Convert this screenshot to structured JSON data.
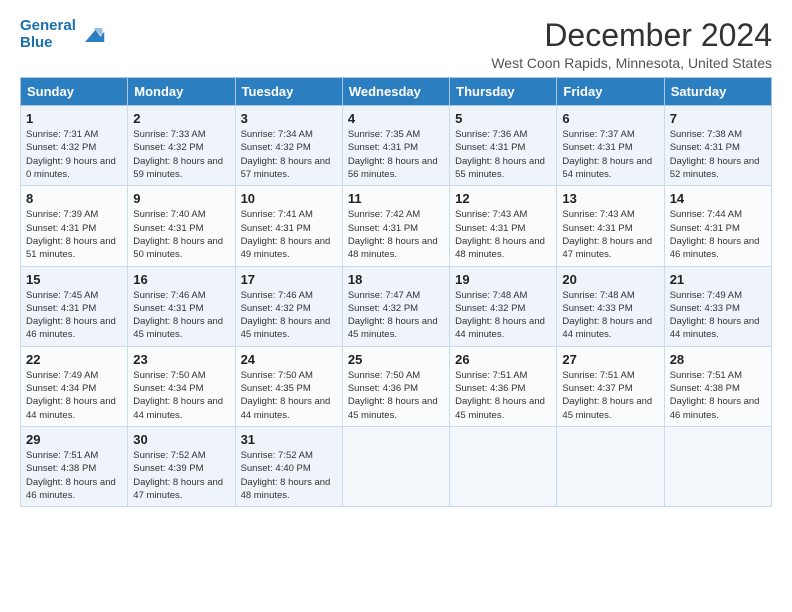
{
  "header": {
    "logo_line1": "General",
    "logo_line2": "Blue",
    "month": "December 2024",
    "location": "West Coon Rapids, Minnesota, United States"
  },
  "days_of_week": [
    "Sunday",
    "Monday",
    "Tuesday",
    "Wednesday",
    "Thursday",
    "Friday",
    "Saturday"
  ],
  "weeks": [
    [
      {
        "day": "1",
        "sunrise": "7:31 AM",
        "sunset": "4:32 PM",
        "daylight": "9 hours and 0 minutes."
      },
      {
        "day": "2",
        "sunrise": "7:33 AM",
        "sunset": "4:32 PM",
        "daylight": "8 hours and 59 minutes."
      },
      {
        "day": "3",
        "sunrise": "7:34 AM",
        "sunset": "4:32 PM",
        "daylight": "8 hours and 57 minutes."
      },
      {
        "day": "4",
        "sunrise": "7:35 AM",
        "sunset": "4:31 PM",
        "daylight": "8 hours and 56 minutes."
      },
      {
        "day": "5",
        "sunrise": "7:36 AM",
        "sunset": "4:31 PM",
        "daylight": "8 hours and 55 minutes."
      },
      {
        "day": "6",
        "sunrise": "7:37 AM",
        "sunset": "4:31 PM",
        "daylight": "8 hours and 54 minutes."
      },
      {
        "day": "7",
        "sunrise": "7:38 AM",
        "sunset": "4:31 PM",
        "daylight": "8 hours and 52 minutes."
      }
    ],
    [
      {
        "day": "8",
        "sunrise": "7:39 AM",
        "sunset": "4:31 PM",
        "daylight": "8 hours and 51 minutes."
      },
      {
        "day": "9",
        "sunrise": "7:40 AM",
        "sunset": "4:31 PM",
        "daylight": "8 hours and 50 minutes."
      },
      {
        "day": "10",
        "sunrise": "7:41 AM",
        "sunset": "4:31 PM",
        "daylight": "8 hours and 49 minutes."
      },
      {
        "day": "11",
        "sunrise": "7:42 AM",
        "sunset": "4:31 PM",
        "daylight": "8 hours and 48 minutes."
      },
      {
        "day": "12",
        "sunrise": "7:43 AM",
        "sunset": "4:31 PM",
        "daylight": "8 hours and 48 minutes."
      },
      {
        "day": "13",
        "sunrise": "7:43 AM",
        "sunset": "4:31 PM",
        "daylight": "8 hours and 47 minutes."
      },
      {
        "day": "14",
        "sunrise": "7:44 AM",
        "sunset": "4:31 PM",
        "daylight": "8 hours and 46 minutes."
      }
    ],
    [
      {
        "day": "15",
        "sunrise": "7:45 AM",
        "sunset": "4:31 PM",
        "daylight": "8 hours and 46 minutes."
      },
      {
        "day": "16",
        "sunrise": "7:46 AM",
        "sunset": "4:31 PM",
        "daylight": "8 hours and 45 minutes."
      },
      {
        "day": "17",
        "sunrise": "7:46 AM",
        "sunset": "4:32 PM",
        "daylight": "8 hours and 45 minutes."
      },
      {
        "day": "18",
        "sunrise": "7:47 AM",
        "sunset": "4:32 PM",
        "daylight": "8 hours and 45 minutes."
      },
      {
        "day": "19",
        "sunrise": "7:48 AM",
        "sunset": "4:32 PM",
        "daylight": "8 hours and 44 minutes."
      },
      {
        "day": "20",
        "sunrise": "7:48 AM",
        "sunset": "4:33 PM",
        "daylight": "8 hours and 44 minutes."
      },
      {
        "day": "21",
        "sunrise": "7:49 AM",
        "sunset": "4:33 PM",
        "daylight": "8 hours and 44 minutes."
      }
    ],
    [
      {
        "day": "22",
        "sunrise": "7:49 AM",
        "sunset": "4:34 PM",
        "daylight": "8 hours and 44 minutes."
      },
      {
        "day": "23",
        "sunrise": "7:50 AM",
        "sunset": "4:34 PM",
        "daylight": "8 hours and 44 minutes."
      },
      {
        "day": "24",
        "sunrise": "7:50 AM",
        "sunset": "4:35 PM",
        "daylight": "8 hours and 44 minutes."
      },
      {
        "day": "25",
        "sunrise": "7:50 AM",
        "sunset": "4:36 PM",
        "daylight": "8 hours and 45 minutes."
      },
      {
        "day": "26",
        "sunrise": "7:51 AM",
        "sunset": "4:36 PM",
        "daylight": "8 hours and 45 minutes."
      },
      {
        "day": "27",
        "sunrise": "7:51 AM",
        "sunset": "4:37 PM",
        "daylight": "8 hours and 45 minutes."
      },
      {
        "day": "28",
        "sunrise": "7:51 AM",
        "sunset": "4:38 PM",
        "daylight": "8 hours and 46 minutes."
      }
    ],
    [
      {
        "day": "29",
        "sunrise": "7:51 AM",
        "sunset": "4:38 PM",
        "daylight": "8 hours and 46 minutes."
      },
      {
        "day": "30",
        "sunrise": "7:52 AM",
        "sunset": "4:39 PM",
        "daylight": "8 hours and 47 minutes."
      },
      {
        "day": "31",
        "sunrise": "7:52 AM",
        "sunset": "4:40 PM",
        "daylight": "8 hours and 48 minutes."
      },
      {
        "day": "",
        "sunrise": "",
        "sunset": "",
        "daylight": ""
      },
      {
        "day": "",
        "sunrise": "",
        "sunset": "",
        "daylight": ""
      },
      {
        "day": "",
        "sunrise": "",
        "sunset": "",
        "daylight": ""
      },
      {
        "day": "",
        "sunrise": "",
        "sunset": "",
        "daylight": ""
      }
    ]
  ]
}
